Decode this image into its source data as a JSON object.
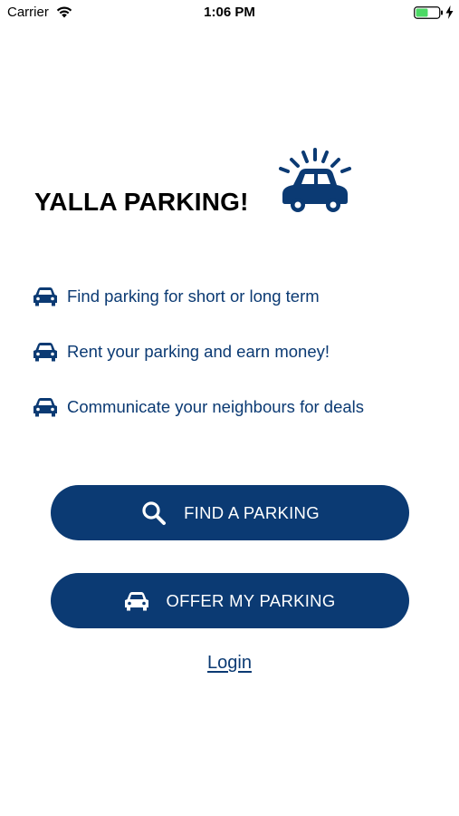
{
  "status_bar": {
    "carrier": "Carrier",
    "time": "1:06 PM",
    "wifi_icon": "wifi-icon",
    "battery_icon": "battery-icon",
    "charging_icon": "bolt-icon"
  },
  "header": {
    "title": "YALLA PARKING!",
    "icon": "car-alarm-icon"
  },
  "features": [
    {
      "icon": "car-icon",
      "text": "Find parking for short or long term"
    },
    {
      "icon": "car-icon",
      "text": "Rent your parking and earn money!"
    },
    {
      "icon": "car-icon",
      "text": "Communicate your neighbours for deals"
    }
  ],
  "actions": {
    "find_label": "FIND A PARKING",
    "find_icon": "search-icon",
    "offer_label": "OFFER MY PARKING",
    "offer_icon": "car-icon",
    "login_label": "Login"
  },
  "colors": {
    "brand": "#0b3a73",
    "battery_fill": "#4cd964",
    "background": "#ffffff"
  }
}
